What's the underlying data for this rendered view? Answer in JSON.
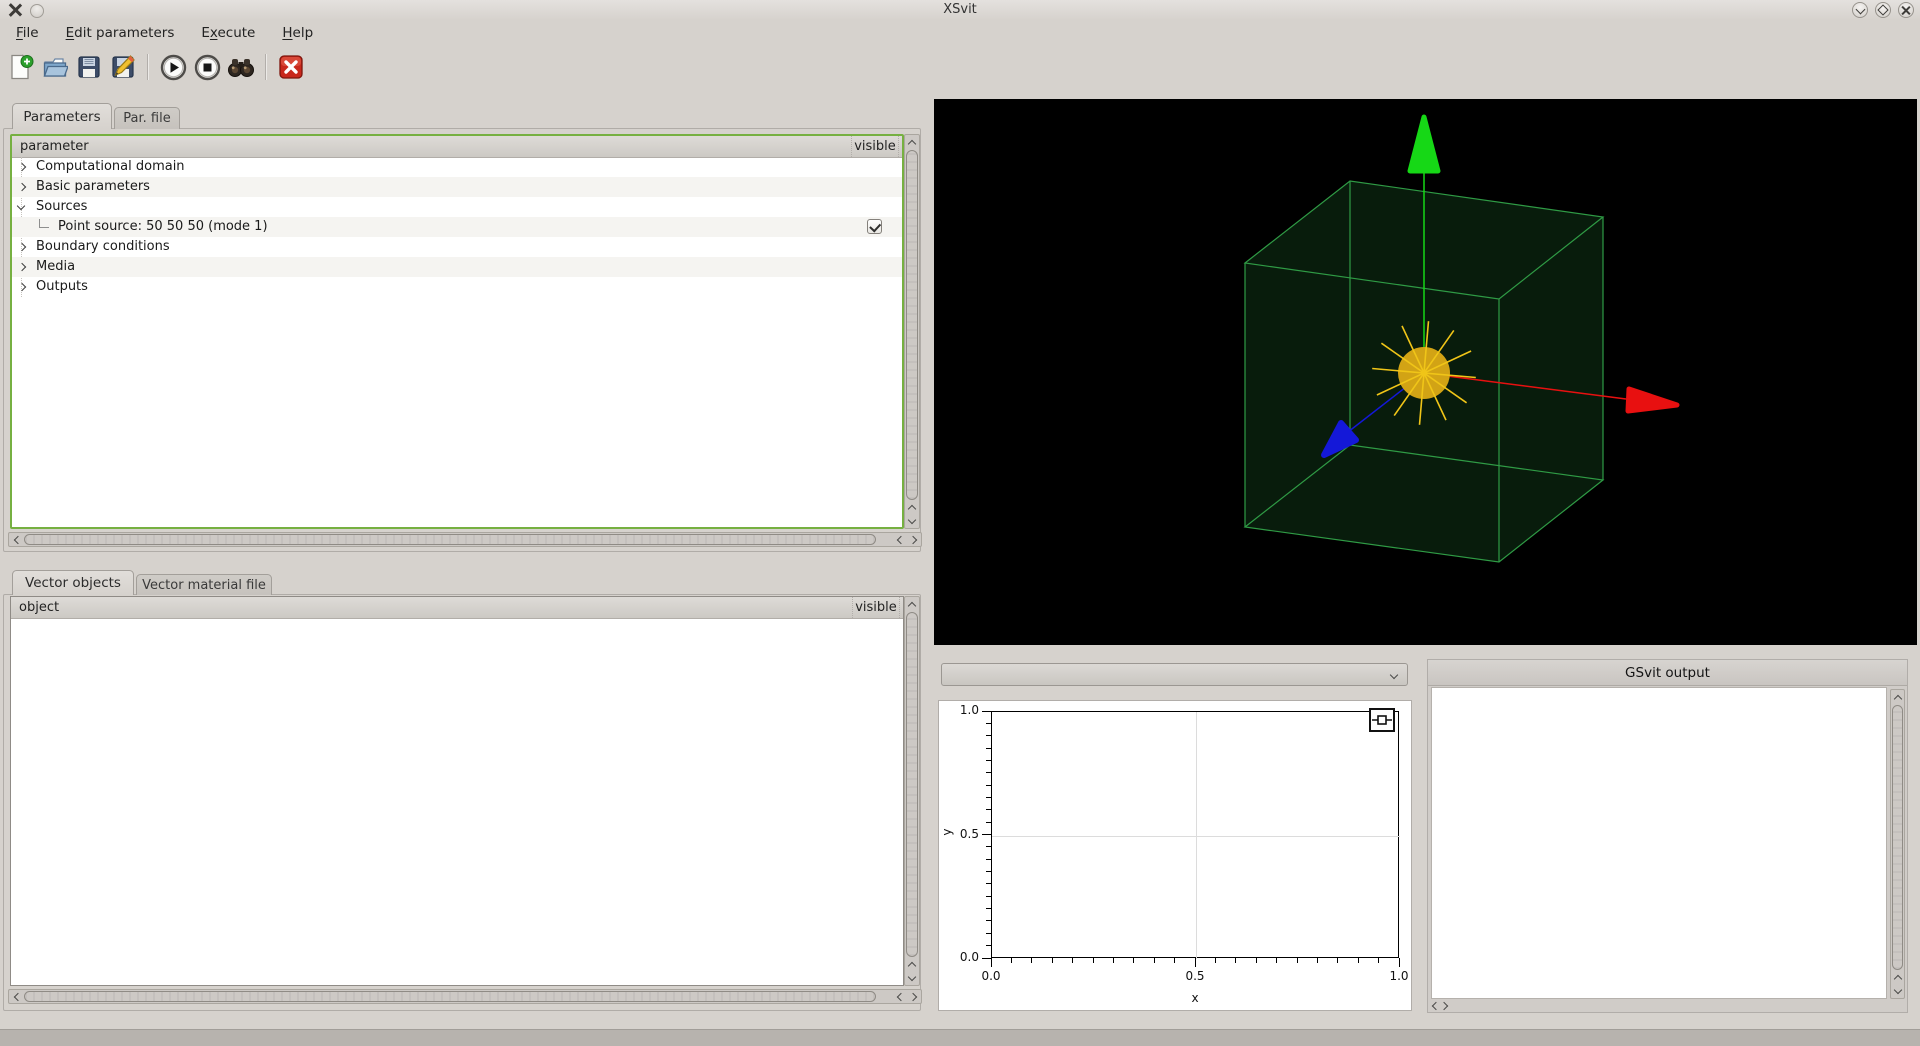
{
  "window": {
    "title": "XSvit"
  },
  "menubar": {
    "items": [
      {
        "label": "File",
        "mnemonic": 0
      },
      {
        "label": "Edit parameters",
        "mnemonic": 0
      },
      {
        "label": "Execute",
        "mnemonic": 1
      },
      {
        "label": "Help",
        "mnemonic": 0
      }
    ]
  },
  "toolbar": {
    "buttons": [
      {
        "name": "new-file"
      },
      {
        "name": "open-file"
      },
      {
        "name": "save-file"
      },
      {
        "name": "save-file-as"
      },
      {
        "name": "run-computation"
      },
      {
        "name": "stop-computation"
      },
      {
        "name": "watch-results"
      },
      {
        "name": "quit"
      }
    ]
  },
  "parameters_panel": {
    "tabs": [
      {
        "label": "Parameters",
        "active": true
      },
      {
        "label": "Par. file",
        "active": false
      }
    ],
    "columns": {
      "main": "parameter",
      "visible": "visible"
    },
    "rows": [
      {
        "label": "Computational domain",
        "level": 0,
        "state": "collapsed",
        "checkbox": null
      },
      {
        "label": "Basic parameters",
        "level": 0,
        "state": "collapsed",
        "checkbox": null
      },
      {
        "label": "Sources",
        "level": 0,
        "state": "expanded",
        "checkbox": null
      },
      {
        "label": "Point source: 50 50 50 (mode 1)",
        "level": 1,
        "state": "leaf",
        "checkbox": true
      },
      {
        "label": "Boundary conditions",
        "level": 0,
        "state": "collapsed",
        "checkbox": null
      },
      {
        "label": "Media",
        "level": 0,
        "state": "collapsed",
        "checkbox": null
      },
      {
        "label": "Outputs",
        "level": 0,
        "state": "collapsed",
        "checkbox": null
      }
    ]
  },
  "vector_panel": {
    "tabs": [
      {
        "label": "Vector objects",
        "active": true
      },
      {
        "label": "Vector material file",
        "active": false
      }
    ],
    "columns": {
      "main": "object",
      "visible": "visible"
    },
    "rows": []
  },
  "combobox": {
    "value": ""
  },
  "gsvit_output": {
    "title": "GSvit output",
    "content": ""
  },
  "chart_data": {
    "type": "line",
    "title": "",
    "xlabel": "x",
    "ylabel": "y",
    "xlim": [
      0.0,
      1.0
    ],
    "ylim": [
      0.0,
      1.0
    ],
    "xticks": [
      0.0,
      0.5,
      1.0
    ],
    "yticks": [
      0.0,
      0.5,
      1.0
    ],
    "minor_tick_step": 0.05,
    "tick_decimals": 1,
    "grid": true,
    "grid_x": [
      0.5
    ],
    "grid_y": [
      0.5
    ],
    "legend_position": "top-right",
    "series": []
  },
  "colors": {
    "window_bg": "#d6d2cd",
    "band_bg": "#b7b3ae",
    "accent_focus": "#76b041",
    "gl_bg": "#000000",
    "cube_edge": "#2f9b45",
    "cube_fill": "#081c0c",
    "axis_x": "#e81010",
    "axis_y": "#16d816",
    "axis_z": "#1418d8",
    "source": "#d2a315",
    "ray": "#f0c518",
    "plot_grid": "#dcdcdc",
    "close_red": "#c8281c"
  }
}
